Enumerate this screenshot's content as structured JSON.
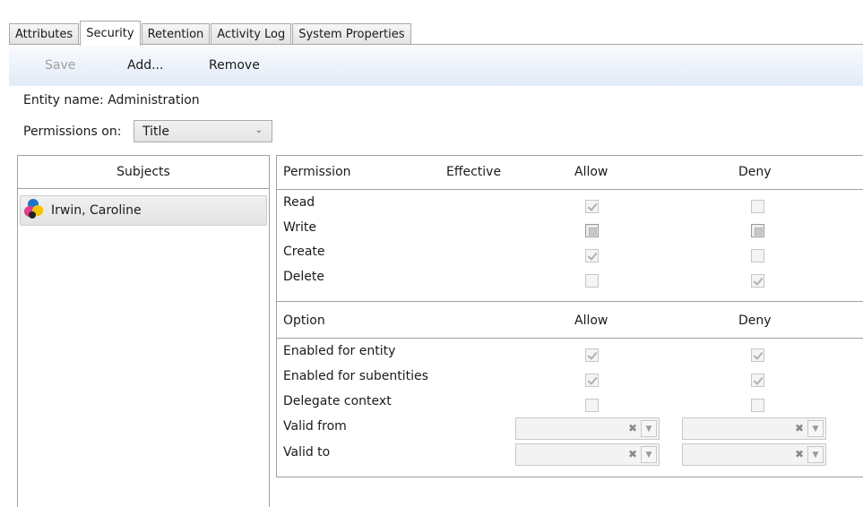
{
  "tabs": [
    {
      "label": "Attributes"
    },
    {
      "label": "Security"
    },
    {
      "label": "Retention"
    },
    {
      "label": "Activity Log"
    },
    {
      "label": "System Properties"
    }
  ],
  "toolbar": {
    "save": "Save",
    "add": "Add...",
    "remove": "Remove"
  },
  "entity": {
    "label": "Entity name:",
    "value": "Administration"
  },
  "permissions_on": {
    "label": "Permissions on:",
    "value": "Title"
  },
  "subjects": {
    "header": "Subjects",
    "items": [
      {
        "name": "Irwin, Caroline",
        "icon": "group-icon"
      }
    ]
  },
  "permissions": {
    "headers": {
      "permission": "Permission",
      "effective": "Effective",
      "allow": "Allow",
      "deny": "Deny"
    },
    "rows": [
      {
        "name": "Read",
        "allow": "checked",
        "deny": "unchecked"
      },
      {
        "name": "Write",
        "allow": "indeterminate",
        "deny": "indeterminate"
      },
      {
        "name": "Create",
        "allow": "checked",
        "deny": "unchecked"
      },
      {
        "name": "Delete",
        "allow": "unchecked",
        "deny": "checked"
      }
    ]
  },
  "options": {
    "headers": {
      "option": "Option",
      "allow": "Allow",
      "deny": "Deny"
    },
    "rows": [
      {
        "name": "Enabled for entity",
        "allow": "checked",
        "deny": "checked"
      },
      {
        "name": "Enabled for subentities",
        "allow": "checked",
        "deny": "checked"
      },
      {
        "name": "Delegate context",
        "allow": "unchecked",
        "deny": "unchecked"
      }
    ],
    "valid_from": "Valid from",
    "valid_to": "Valid to"
  }
}
